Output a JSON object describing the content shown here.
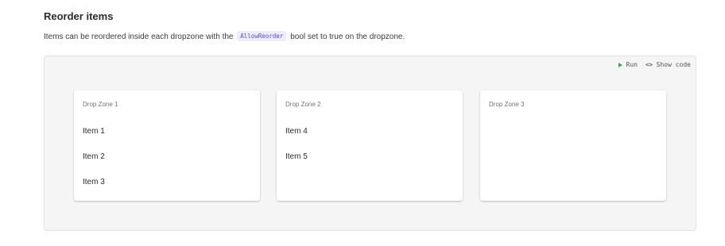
{
  "section": {
    "title": "Reorder items",
    "description_before": "Items can be reordered inside each dropzone with the",
    "description_code": "AllowReorder",
    "description_after": "bool set to true on the dropzone."
  },
  "toolbar": {
    "run_label": "Run",
    "run_icon": "play-icon",
    "show_code_label": "Show code",
    "show_code_icon": "code-icon",
    "run_icon_color": "#3aa657"
  },
  "zones": [
    {
      "title": "Drop Zone 1",
      "items": [
        "Item 1",
        "Item 2",
        "Item 3"
      ]
    },
    {
      "title": "Drop Zone 2",
      "items": [
        "Item 4",
        "Item 5"
      ]
    },
    {
      "title": "Drop Zone 3",
      "items": []
    }
  ],
  "colors": {
    "code_text": "#594ae2",
    "code_background": "#ececfb",
    "panel_background": "#f5f5f5"
  }
}
